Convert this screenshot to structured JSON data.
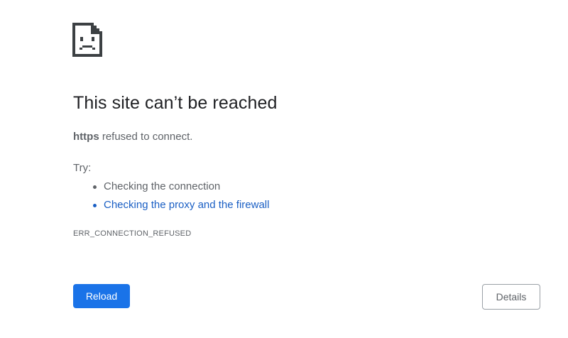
{
  "error": {
    "icon": "sad-page-icon",
    "title": "This site can’t be reached",
    "host": "https",
    "message_rest": " refused to connect.",
    "try_label": "Try:",
    "suggestions": [
      {
        "label": "Checking the connection",
        "is_link": false
      },
      {
        "label": "Checking the proxy and the firewall",
        "is_link": true
      }
    ],
    "error_code": "ERR_CONNECTION_REFUSED"
  },
  "buttons": {
    "reload_label": "Reload",
    "details_label": "Details"
  },
  "colors": {
    "accent": "#1a73e8",
    "link": "#1a5fc4",
    "text_primary": "#202124",
    "text_secondary": "#5f6368"
  }
}
